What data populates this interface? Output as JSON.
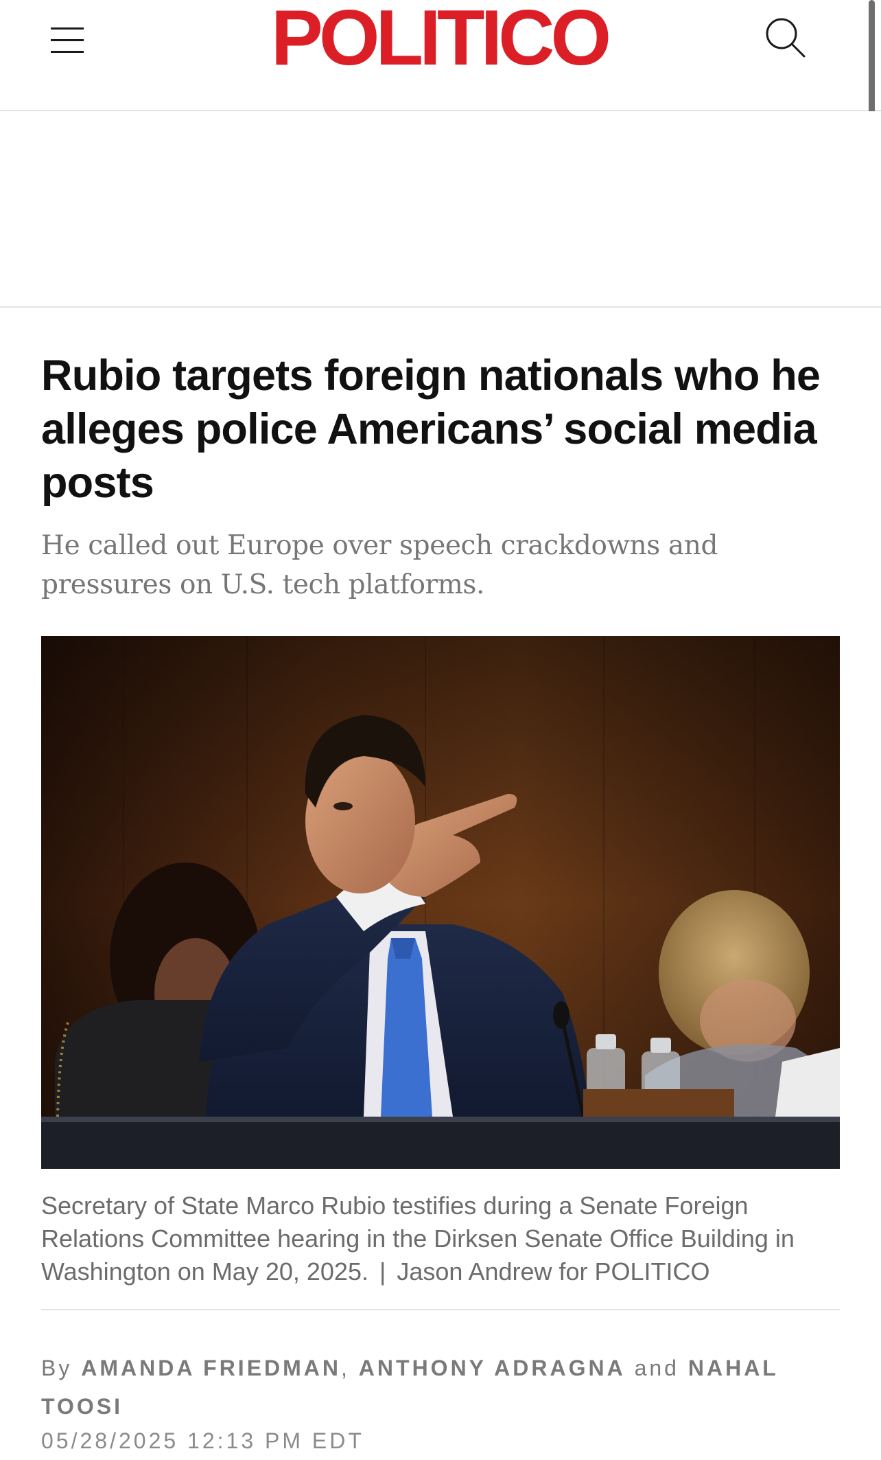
{
  "header": {
    "logo_text": "POLITICO",
    "brand_color": "#dc1f26",
    "menu_icon": "hamburger-menu-icon",
    "search_icon": "search-icon"
  },
  "article": {
    "headline": "Rubio targets foreign nationals who he alleges police Americans’ social media posts",
    "dek": "He called out Europe over speech crackdowns and pressures on U.S. tech platforms.",
    "image_alt": "Secretary of State Marco Rubio pointing during a Senate hearing",
    "caption": {
      "text": "Secretary of State Marco Rubio testifies during a Senate Foreign Relations Committee hearing in the Dirksen Senate Office Building in Washington on May 20, 2025.",
      "separator": "|",
      "credit": "Jason Andrew for POLITICO"
    },
    "byline": {
      "prefix": "By",
      "authors": [
        "Amanda Friedman",
        "Anthony Adragna",
        "Nahal Toosi"
      ],
      "comma": ",",
      "conjunction": "and"
    },
    "timestamp": "05/28/2025 12:13 PM EDT"
  }
}
